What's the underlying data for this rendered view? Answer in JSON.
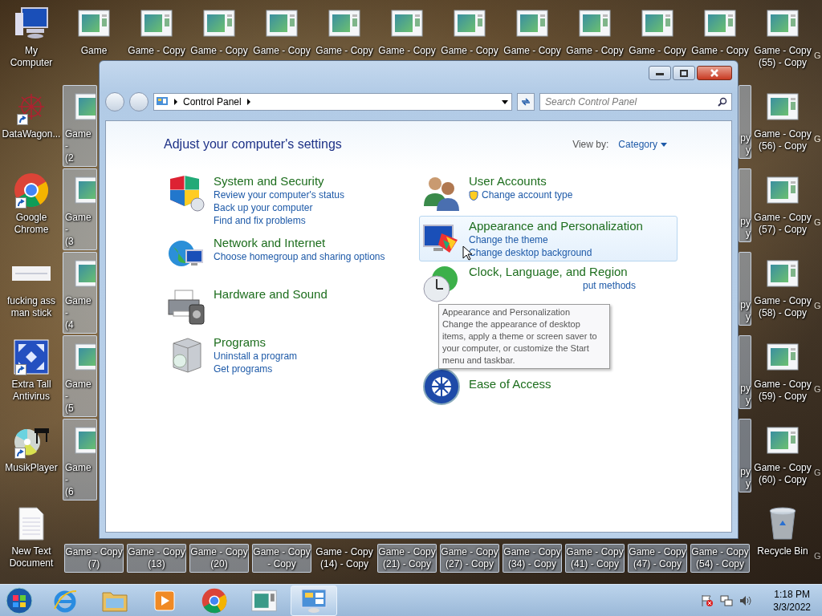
{
  "desktop": {
    "left_column": [
      {
        "label": "My Computer",
        "kind": "computer",
        "shortcut": false
      },
      {
        "label": "DataWagon...",
        "kind": "web",
        "shortcut": true
      },
      {
        "label": "Google Chrome",
        "kind": "chrome",
        "shortcut": true
      },
      {
        "label": "fucking ass man stick",
        "kind": "image",
        "shortcut": false
      },
      {
        "label": "Extra Tall Antivirus",
        "kind": "antivirus",
        "shortcut": true
      },
      {
        "label": "MusikPlayer",
        "kind": "music",
        "shortcut": true
      },
      {
        "label": "New Text Document",
        "kind": "text",
        "shortcut": false
      }
    ],
    "top_row": [
      {
        "label": "Game",
        "selected": false
      },
      {
        "label": "Game - Copy",
        "selected": false
      },
      {
        "label": "Game - Copy",
        "selected": false
      },
      {
        "label": "Game - Copy",
        "selected": false
      },
      {
        "label": "Game - Copy",
        "selected": false
      },
      {
        "label": "Game - Copy",
        "selected": false
      },
      {
        "label": "Game - Copy",
        "selected": false
      },
      {
        "label": "Game - Copy",
        "selected": false
      },
      {
        "label": "Game - Copy",
        "selected": false
      },
      {
        "label": "Game - Copy",
        "selected": false
      },
      {
        "label": "Game - Copy",
        "selected": false
      },
      {
        "label": "Game - Copy (55) - Copy",
        "selected": false
      }
    ],
    "left_partial": [
      {
        "lines": [
          "Game -",
          "(2"
        ],
        "selected": true
      },
      {
        "lines": [
          "Game -",
          "(3"
        ],
        "selected": true
      },
      {
        "lines": [
          "Game -",
          "(4"
        ],
        "selected": true
      },
      {
        "lines": [
          "Game -",
          "(5"
        ],
        "selected": true
      },
      {
        "lines": [
          "Game -",
          "(6"
        ],
        "selected": true
      }
    ],
    "right_partial": [
      {
        "lines": [
          "py",
          "y"
        ],
        "selected": true
      },
      {
        "lines": [
          "py",
          "y"
        ],
        "selected": true
      },
      {
        "lines": [
          "py",
          "y"
        ],
        "selected": true
      },
      {
        "lines": [
          "py",
          "y"
        ],
        "selected": true
      },
      {
        "lines": [
          "py",
          "y"
        ],
        "selected": true
      }
    ],
    "right_column": [
      {
        "label": "Game - Copy (56) - Copy",
        "kind": "game"
      },
      {
        "label": "Game - Copy (57) - Copy",
        "kind": "game"
      },
      {
        "label": "Game - Copy (58) - Copy",
        "kind": "game"
      },
      {
        "label": "Game - Copy (59) - Copy",
        "kind": "game"
      },
      {
        "label": "Game - Copy (60) - Copy",
        "kind": "game"
      },
      {
        "label": "Recycle Bin",
        "kind": "recycle"
      }
    ],
    "bottom_row": [
      {
        "label": "Game - Copy (7)",
        "selected": true
      },
      {
        "label": "Game - Copy (13)",
        "selected": true
      },
      {
        "label": "Game - Copy (20)",
        "selected": true
      },
      {
        "label": "Game - Copy - Copy",
        "selected": true
      },
      {
        "label": "Game - Copy (14) - Copy",
        "selected": false
      },
      {
        "label": "Game - Copy (21) - Copy",
        "selected": true
      },
      {
        "label": "Game - Copy (27) - Copy",
        "selected": true
      },
      {
        "label": "Game - Copy (34) - Copy",
        "selected": true
      },
      {
        "label": "Game - Copy (41) - Copy",
        "selected": true
      },
      {
        "label": "Game - Copy (47) - Copy",
        "selected": true
      },
      {
        "label": "Game - Copy (54) - Copy",
        "selected": true
      }
    ],
    "far_right": [
      "G",
      "G",
      "G",
      "G",
      "G",
      "G",
      "G"
    ]
  },
  "window": {
    "breadcrumb": "Control Panel",
    "search": {
      "placeholder": "Search Control Panel"
    },
    "heading": "Adjust your computer's settings",
    "view_by": {
      "label": "View by:",
      "value": "Category"
    },
    "columns": [
      [
        {
          "kind": "security",
          "title": "System and Security",
          "hovered": false,
          "links": [
            "Review your computer's status",
            "Back up your computer",
            "Find and fix problems"
          ]
        },
        {
          "kind": "network",
          "title": "Network and Internet",
          "hovered": false,
          "links": [
            "Choose homegroup and sharing options"
          ]
        },
        {
          "kind": "hardware",
          "title": "Hardware and Sound",
          "hovered": false
        },
        {
          "kind": "programs",
          "title": "Programs",
          "hovered": false,
          "links": [
            "Uninstall a program",
            "Get programs"
          ]
        }
      ],
      [
        {
          "kind": "users",
          "title": "User Accounts",
          "hovered": false,
          "links": [
            "Change account type"
          ]
        },
        {
          "kind": "appearance",
          "title": "Appearance and Personalization",
          "hovered": true,
          "links": [
            "Change the theme",
            "Change desktop background"
          ]
        },
        {
          "kind": "clock",
          "title": "Clock, Language, and Region",
          "hovered": false,
          "links": [
            "put methods"
          ]
        },
        {
          "kind": "ease",
          "title": "Ease of Access",
          "hovered": false
        }
      ]
    ],
    "tooltip": {
      "title": "Appearance and Personalization",
      "text": "Change the appearance of desktop items, apply a theme or screen saver to your computer, or customize the Start menu and taskbar."
    }
  },
  "taskbar": {
    "items": [
      {
        "kind": "ie",
        "active": false
      },
      {
        "kind": "explorer",
        "active": false
      },
      {
        "kind": "media",
        "active": false
      },
      {
        "kind": "chrome",
        "active": false
      },
      {
        "kind": "game",
        "active": false
      },
      {
        "kind": "control",
        "active": true
      }
    ],
    "time": "1:18 PM",
    "date": "3/3/2022"
  }
}
